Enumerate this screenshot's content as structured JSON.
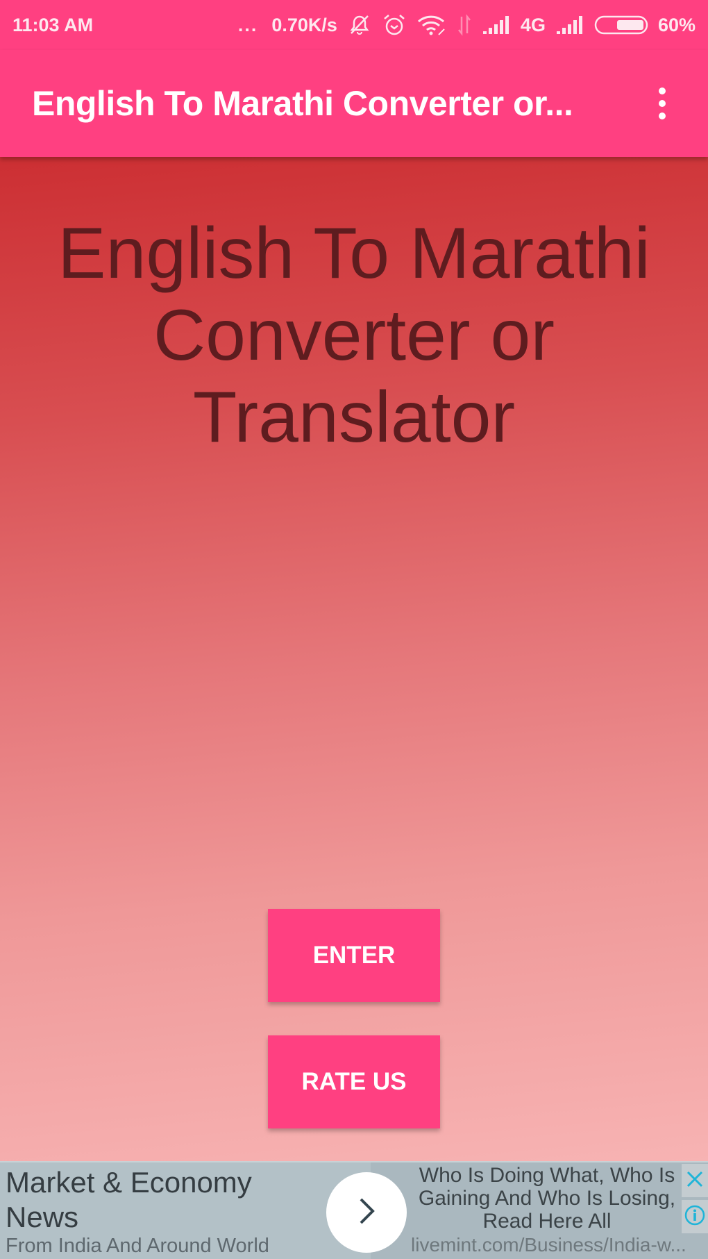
{
  "status_bar": {
    "time": "11:03 AM",
    "more_indicator": "...",
    "network_speed": "0.70K/s",
    "icons": [
      "muted-bell-icon",
      "alarm-icon",
      "wifi-icon",
      "data-arrows-icon",
      "signal-icon",
      "signal-icon"
    ],
    "network_type": "4G",
    "battery_percent": "60%",
    "battery_level": 0.6
  },
  "app_bar": {
    "title": "English To Marathi Converter or...",
    "overflow_icon": "more-vert-icon"
  },
  "main": {
    "heading": "English To Marathi Converter or Translator",
    "buttons": {
      "enter": "ENTER",
      "rate_us": "RATE US"
    }
  },
  "ad_banner": {
    "headline": "Market & Economy News",
    "subline": "From India And Around World",
    "description": "Who Is Doing What, Who Is Gaining And Who Is Losing, Read Here All",
    "url": "livemint.com/Business/India-w...",
    "go_icon": "chevron-right-icon",
    "close_icon": "close-icon",
    "info_icon": "info-icon"
  },
  "colors": {
    "accent": "#ff4081",
    "heading_text": "#5e1c1f",
    "gradient_top": "#cc2f33",
    "gradient_bottom": "#f7b3b3",
    "ad_background": "#b3c1c7",
    "ad_icon": "#1fb4d8"
  }
}
